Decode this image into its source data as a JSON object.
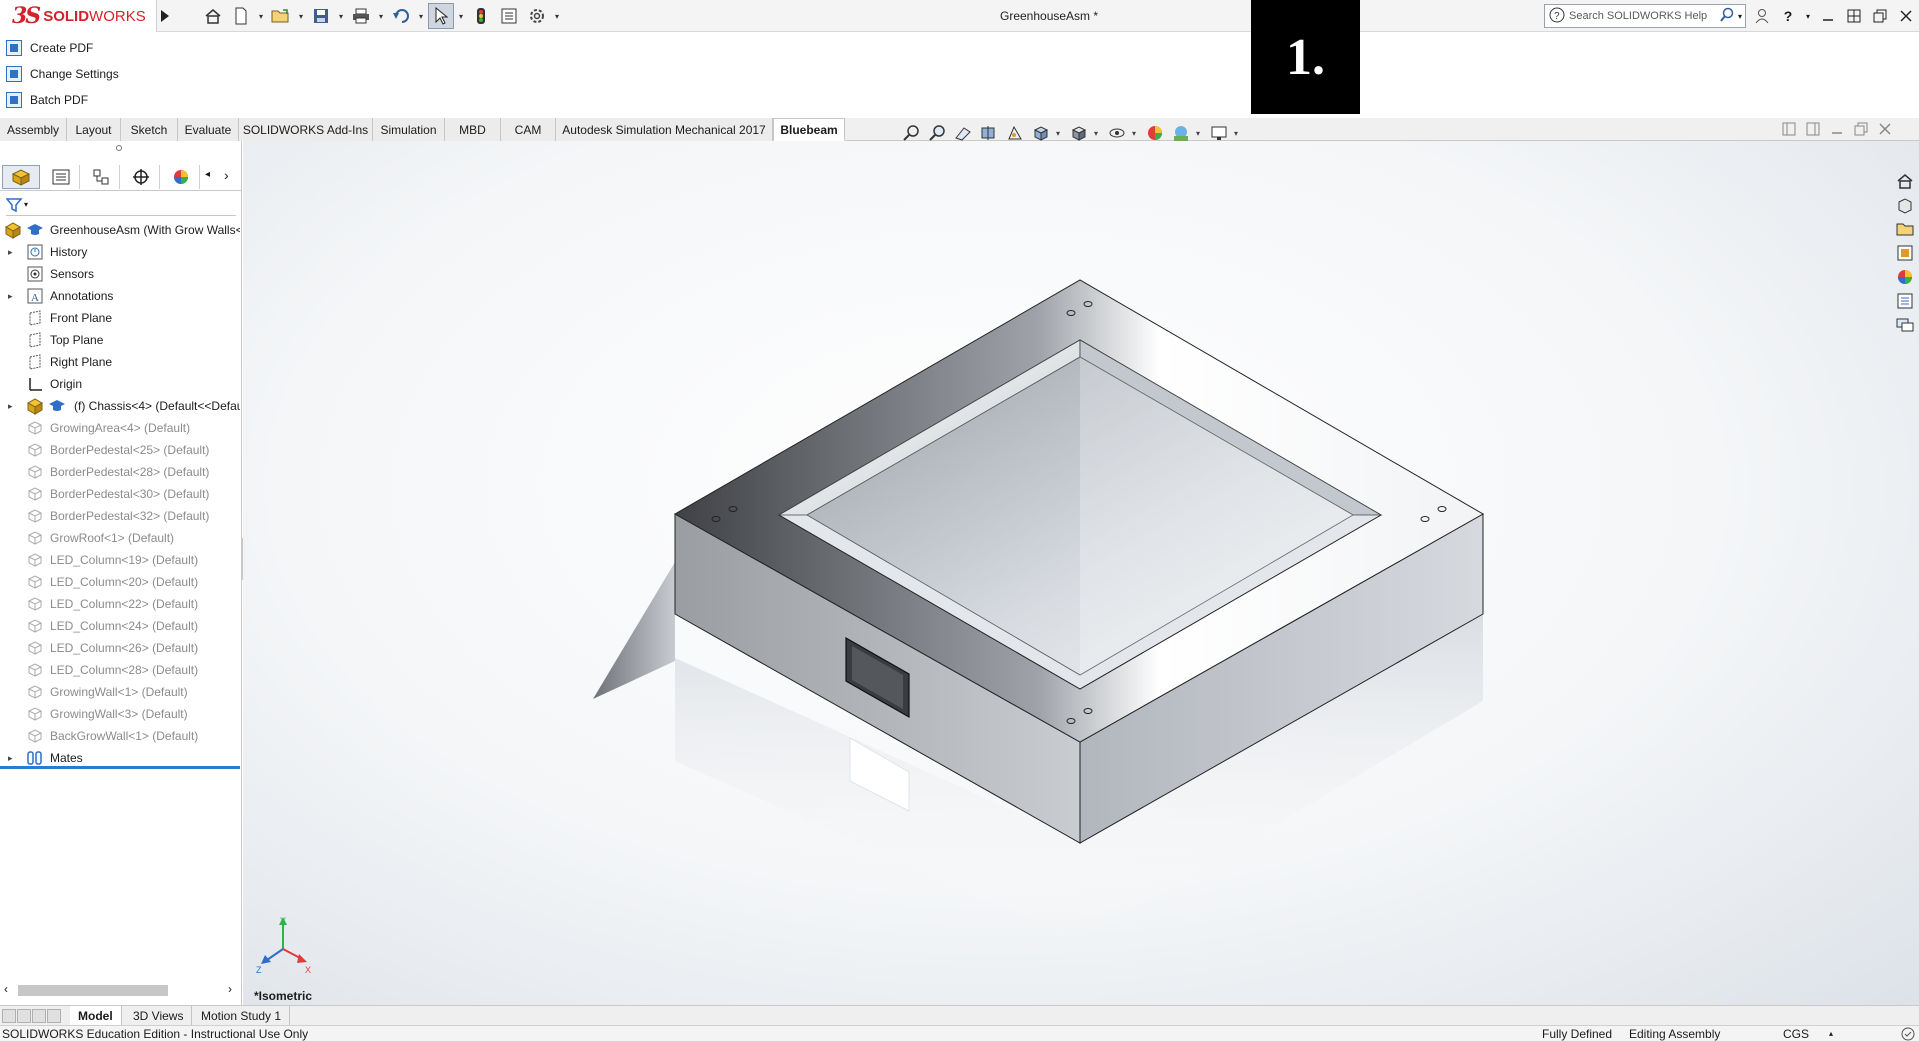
{
  "app": {
    "brand_ds": "3S",
    "brand_solid": "SOLID",
    "brand_works": "WORKS",
    "doc_title": "GreenhouseAsm *"
  },
  "search": {
    "placeholder": "Search SOLIDWORKS Help"
  },
  "quick_access": {
    "icons": [
      "home-icon",
      "new-document-icon",
      "open-icon",
      "save-icon",
      "print-icon",
      "undo-icon",
      "select-icon",
      "rebuild-icon",
      "file-properties-icon",
      "options-icon"
    ]
  },
  "marker": {
    "text": "1."
  },
  "bluebeam": {
    "items": [
      {
        "label": "Create PDF"
      },
      {
        "label": "Change Settings"
      },
      {
        "label": "Batch PDF"
      }
    ]
  },
  "command_tabs": [
    {
      "label": "Assembly"
    },
    {
      "label": "Layout"
    },
    {
      "label": "Sketch"
    },
    {
      "label": "Evaluate"
    },
    {
      "label": "SOLIDWORKS Add-Ins"
    },
    {
      "label": "Simulation"
    },
    {
      "label": "MBD"
    },
    {
      "label": "CAM"
    },
    {
      "label": "Autodesk Simulation Mechanical 2017"
    },
    {
      "label": "Bluebeam"
    }
  ],
  "active_tab": "Bluebeam",
  "tree": {
    "root": "GreenhouseAsm  (With Grow Walls<",
    "items": [
      {
        "label": "History",
        "expandable": true,
        "icon": "history-icon"
      },
      {
        "label": "Sensors",
        "expandable": false,
        "icon": "sensor-icon"
      },
      {
        "label": "Annotations",
        "expandable": true,
        "icon": "annotation-icon"
      },
      {
        "label": "Front Plane",
        "expandable": false,
        "icon": "plane-icon"
      },
      {
        "label": "Top Plane",
        "expandable": false,
        "icon": "plane-icon"
      },
      {
        "label": "Right Plane",
        "expandable": false,
        "icon": "plane-icon"
      },
      {
        "label": "Origin",
        "expandable": false,
        "icon": "origin-icon"
      },
      {
        "label": "(f) Chassis<4> (Default<<Defau",
        "expandable": true,
        "icon": "part-icon"
      }
    ],
    "suppressed": [
      {
        "label": "GrowingArea<4> (Default)"
      },
      {
        "label": "BorderPedestal<25> (Default)"
      },
      {
        "label": "BorderPedestal<28> (Default)"
      },
      {
        "label": "BorderPedestal<30> (Default)"
      },
      {
        "label": "BorderPedestal<32> (Default)"
      },
      {
        "label": "GrowRoof<1> (Default)"
      },
      {
        "label": "LED_Column<19> (Default)"
      },
      {
        "label": "LED_Column<20> (Default)"
      },
      {
        "label": "LED_Column<22> (Default)"
      },
      {
        "label": "LED_Column<24> (Default)"
      },
      {
        "label": "LED_Column<26> (Default)"
      },
      {
        "label": "LED_Column<28> (Default)"
      },
      {
        "label": "GrowingWall<1> (Default)"
      },
      {
        "label": "GrowingWall<3> (Default)"
      },
      {
        "label": "BackGrowWall<1> (Default)"
      }
    ],
    "mates": "Mates"
  },
  "viewport": {
    "view_name": "*Isometric",
    "triad": {
      "x": "X",
      "y": "Y",
      "z": "Z"
    }
  },
  "bottom_tabs": [
    {
      "label": "Model"
    },
    {
      "label": "3D Views"
    },
    {
      "label": "Motion Study 1"
    }
  ],
  "status": {
    "edition": "SOLIDWORKS Education Edition - Instructional Use Only",
    "defined": "Fully Defined",
    "mode": "Editing Assembly",
    "units": "CGS"
  },
  "colors": {
    "accent": "#2c7bd3",
    "brand": "#d2232a"
  }
}
